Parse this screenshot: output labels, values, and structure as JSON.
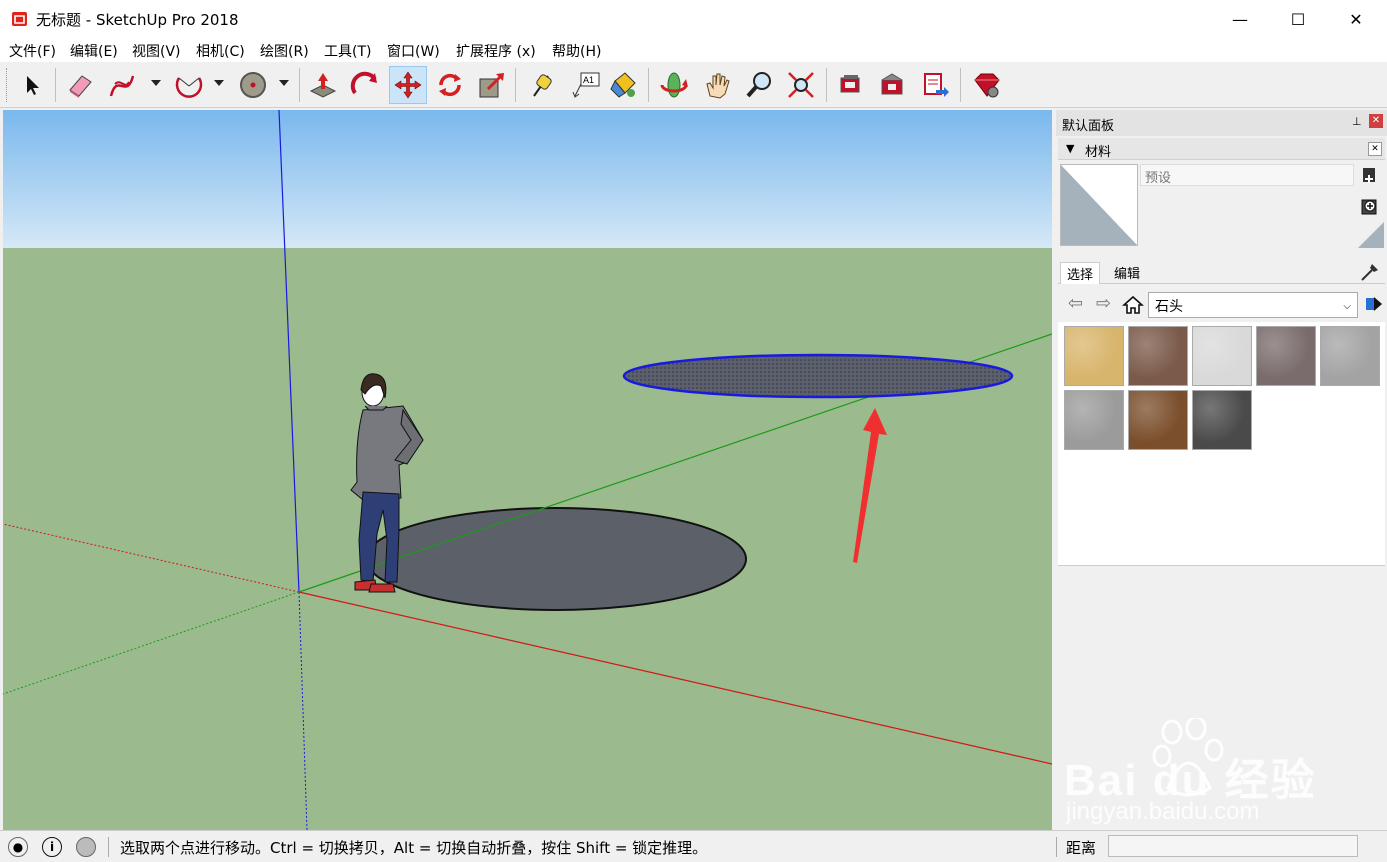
{
  "window": {
    "title": "无标题 - SketchUp Pro 2018",
    "minimize": "—",
    "maximize": "☐",
    "close": "✕"
  },
  "menu": [
    "文件(F)",
    "编辑(E)",
    "视图(V)",
    "相机(C)",
    "绘图(R)",
    "工具(T)",
    "窗口(W)",
    "扩展程序 (x)",
    "帮助(H)"
  ],
  "toolbar": {
    "tools": [
      "select",
      "eraser",
      "freehand",
      "arc",
      "shapes",
      "push-pull",
      "follow-me",
      "move",
      "rotate",
      "scale",
      "tape-measure",
      "text",
      "paint-bucket",
      "orbit",
      "pan",
      "zoom",
      "zoom-extents",
      "warehouse",
      "extension-warehouse",
      "send-to-layout",
      "extension-manager"
    ],
    "active_tool": "move",
    "text_tool_label": "A1"
  },
  "panel": {
    "title": "默认面板",
    "pin": "📌",
    "close": "✕",
    "section_title": "材料",
    "section_collapse": "▼",
    "material_name_placeholder": "预设",
    "tabs": [
      "选择",
      "编辑"
    ],
    "active_tab": "选择",
    "library": "石头",
    "swatches": [
      {
        "name": "sandstone",
        "color": "#d8b56c"
      },
      {
        "name": "brown-granite",
        "color": "#7b5a4a"
      },
      {
        "name": "white-marble",
        "color": "#d9d9d9"
      },
      {
        "name": "grey-granite",
        "color": "#7a6c6c"
      },
      {
        "name": "light-granite",
        "color": "#a3a3a3"
      },
      {
        "name": "grey-concrete",
        "color": "#9b9b9b"
      },
      {
        "name": "brown-stone",
        "color": "#7b4f2c"
      },
      {
        "name": "dark-stone",
        "color": "#4a4a4a"
      }
    ]
  },
  "viewport": {
    "sky_top": "#7ab8ee",
    "sky_bottom": "#d5e8f6",
    "ground": "#9bbb8e",
    "shape_fill": "#5c6169",
    "selection_color": "#1a1adf",
    "annotation_arrow": "#f03030"
  },
  "status": {
    "message": "选取两个点进行移动。Ctrl = 切换拷贝，Alt = 切换自动折叠，按住 Shift = 锁定推理。",
    "distance_label": "距离",
    "distance_value": ""
  },
  "watermark": {
    "brand": "Bai du 经验",
    "url": "jingyan.baidu.com"
  }
}
